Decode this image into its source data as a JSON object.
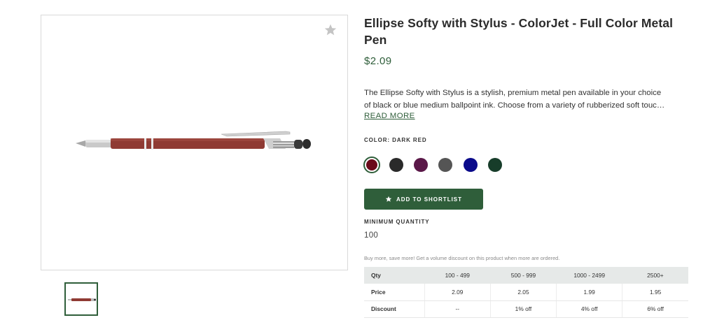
{
  "product": {
    "title_line1": "Ellipse Softy with Stylus - ColorJet - Full Color Metal",
    "title_line2": "Pen",
    "price": "$2.09",
    "description_line1": "The Ellipse Softy with Stylus is a stylish, premium metal pen available in your choice",
    "description_line2": "of black or blue medium ballpoint ink. Choose from a variety of rubberized soft touc…",
    "read_more": "READ MORE"
  },
  "color": {
    "label": "COLOR: DARK RED",
    "swatches": [
      {
        "name": "dark-red",
        "hex": "#6b0a1a",
        "selected": true
      },
      {
        "name": "black",
        "hex": "#2a2a2a",
        "selected": false
      },
      {
        "name": "purple",
        "hex": "#5a1848",
        "selected": false
      },
      {
        "name": "gray",
        "hex": "#555555",
        "selected": false
      },
      {
        "name": "blue",
        "hex": "#0a0a8a",
        "selected": false
      },
      {
        "name": "dark-green",
        "hex": "#173d2a",
        "selected": false
      }
    ]
  },
  "shortlist": {
    "label": "ADD TO SHORTLIST",
    "icon": "star-icon"
  },
  "minimum": {
    "label": "MINIMUM QUANTITY",
    "value": "100"
  },
  "pricing": {
    "note": "Buy more, save more! Get a volume discount on this product when more are ordered.",
    "rows": [
      [
        "Qty",
        "100 - 499",
        "500 - 999",
        "1000 - 2499",
        "2500+"
      ],
      [
        "Price",
        "2.09",
        "2.05",
        "1.99",
        "1.95"
      ],
      [
        "Discount",
        "--",
        "1% off",
        "4% off",
        "6% off"
      ]
    ]
  },
  "colors": {
    "accent": "#2f5e3a",
    "pen_body": "#8f3a33"
  },
  "icons": {
    "favorite": "star-icon"
  }
}
